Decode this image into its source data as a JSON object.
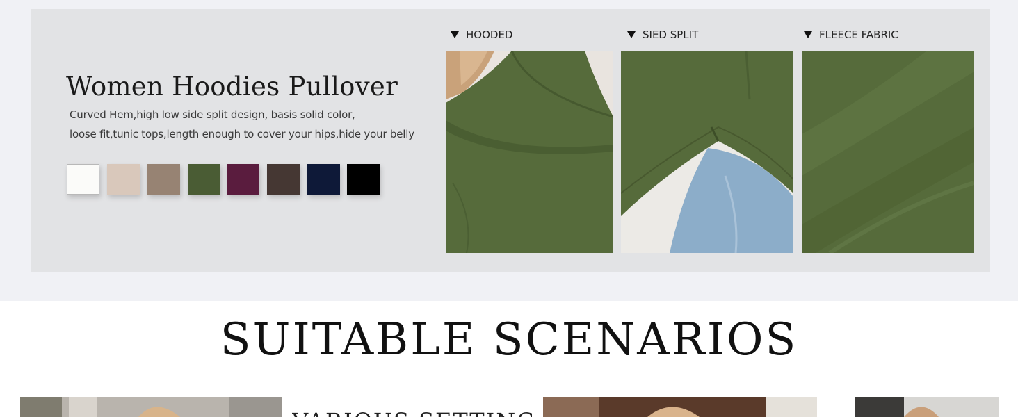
{
  "product": {
    "title": "Women Hoodies Pullover",
    "description_line1": "Curved Hem,high low side split design, basis solid color,",
    "description_line2": "loose fit,tunic tops,length enough to cover your hips,hide your belly"
  },
  "swatches": [
    {
      "color": "#fbfbf9"
    },
    {
      "color": "#d9c8bb"
    },
    {
      "color": "#978373"
    },
    {
      "color": "#4a5c34"
    },
    {
      "color": "#5a1c3e"
    },
    {
      "color": "#453733"
    },
    {
      "color": "#0e1938"
    },
    {
      "color": "#000000"
    }
  ],
  "features": [
    {
      "label": "HOODED"
    },
    {
      "label": "SIED SPLIT"
    },
    {
      "label": "FLEECE FABRIC"
    }
  ],
  "colors": {
    "panel_bg": "#e2e3e5",
    "band_bg": "#f0f1f5",
    "olive": "#566b3b"
  },
  "scenarios": {
    "title": "SUITABLE SCENARIOS",
    "various_settings": "VARIOUS SETTINGS"
  }
}
